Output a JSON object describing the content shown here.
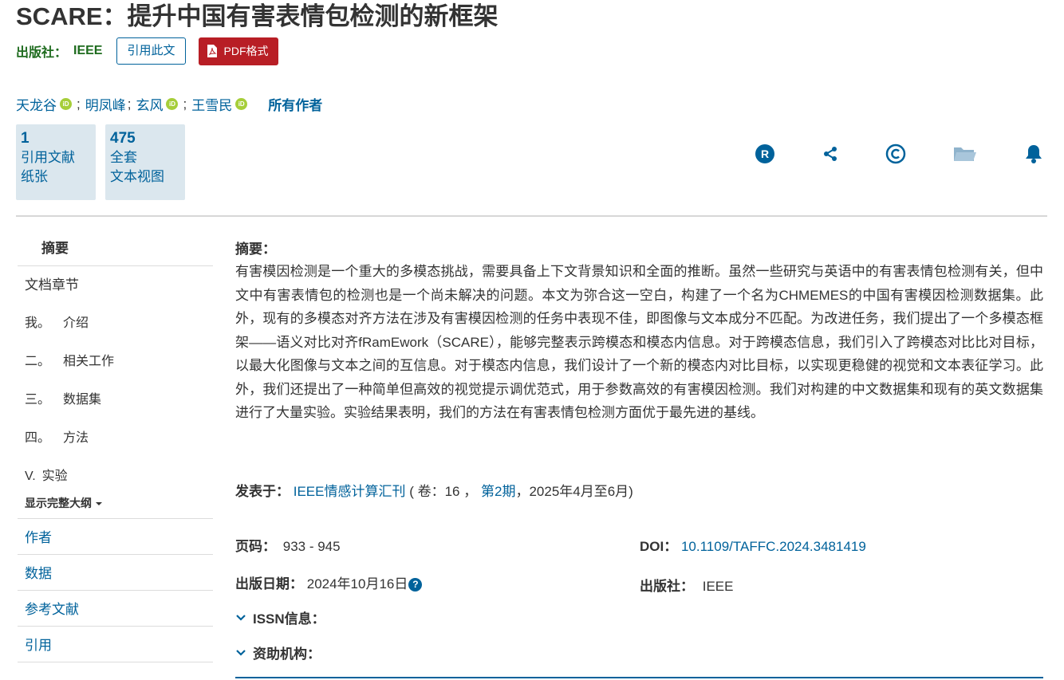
{
  "title": "SCARE：提升中国有害表情包检测的新框架",
  "publisher_row": {
    "label": "出版社：",
    "value": "IEEE",
    "cite_button": "引用此文",
    "pdf_button": "PDF格式"
  },
  "authors": [
    {
      "name": "天龙谷"
    },
    {
      "name": "明凤峰"
    },
    {
      "name": "玄风"
    },
    {
      "name": "王雪民"
    }
  ],
  "all_authors": "所有作者",
  "orcid_label": "iD",
  "author_sep": ";",
  "metrics": [
    {
      "num": "1",
      "l1": "引用文献",
      "l2": "纸张"
    },
    {
      "num": "475",
      "l1": "全套",
      "l2": "文本视图"
    }
  ],
  "toolbar_icons": [
    "rights-icon",
    "share-icon",
    "copyright-icon",
    "folder-icon",
    "bell-icon"
  ],
  "sidebar": {
    "head": "摘要",
    "items": [
      {
        "roman": "",
        "label": "文档章节"
      },
      {
        "roman": "我。",
        "label": "介绍"
      },
      {
        "roman": "二。",
        "label": "相关工作"
      },
      {
        "roman": "三。",
        "label": "数据集"
      },
      {
        "roman": "四。",
        "label": "方法"
      },
      {
        "roman": "V.",
        "label": "实验"
      }
    ],
    "more": "显示完整大纲",
    "links": [
      "作者",
      "数据",
      "参考文献",
      "引用"
    ]
  },
  "abstract": {
    "label": "摘要：",
    "text": "有害模因检测是一个重大的多模态挑战，需要具备上下文背景知识和全面的推断。虽然一些研究与英语中的有害表情包检测有关，但中文中有害表情包的检测也是一个尚未解决的问题。本文为弥合这一空白，构建了一个名为CHMEMES的中国有害模因检测数据集。此外，现有的多模态对齐方法在涉及有害模因检测的任务中表现不佳，即图像与文本成分不匹配。为改进任务，我们提出了一个多模态框架——语义对比对齐fRamEwork（SCARE），能够完整表示跨模态和模态内信息。对于跨模态信息，我们引入了跨模态对比比对目标，以最大化图像与文本之间的互信息。对于模态内信息，我们设计了一个新的模态内对比目标，以实现更稳健的视觉和文本表征学习。此外，我们还提出了一种简单但高效的视觉提示调优范式，用于参数高效的有害模因检测。我们对构建的中文数据集和现有的英文数据集进行了大量实验。实验结果表明，我们的方法在有害表情包检测方面优于最先进的基线。"
  },
  "published_in": {
    "label": "发表于：",
    "journal": "IEEE情感计算汇刊",
    "vol_prefix": "( 卷：16 ，",
    "issue": "第2期",
    "suffix": "，2025年4月至6月)"
  },
  "meta": {
    "pages_label": "页码：",
    "pages": "933 - 945",
    "doi_label": "DOI：",
    "doi": "10.1109/TAFFC.2024.3481419",
    "date_label": "出版日期：",
    "date": "2024年10月16日",
    "help_glyph": "?",
    "publisher_label": "出版社：",
    "publisher": "IEEE"
  },
  "expanders": [
    "ISSN信息：",
    "资助机构："
  ],
  "colors": {
    "link": "#00629b",
    "pdf": "#b81e25",
    "publisher": "#1e6b1e",
    "metric_bg": "#dbe7ee",
    "orcid": "#a6ce39"
  }
}
